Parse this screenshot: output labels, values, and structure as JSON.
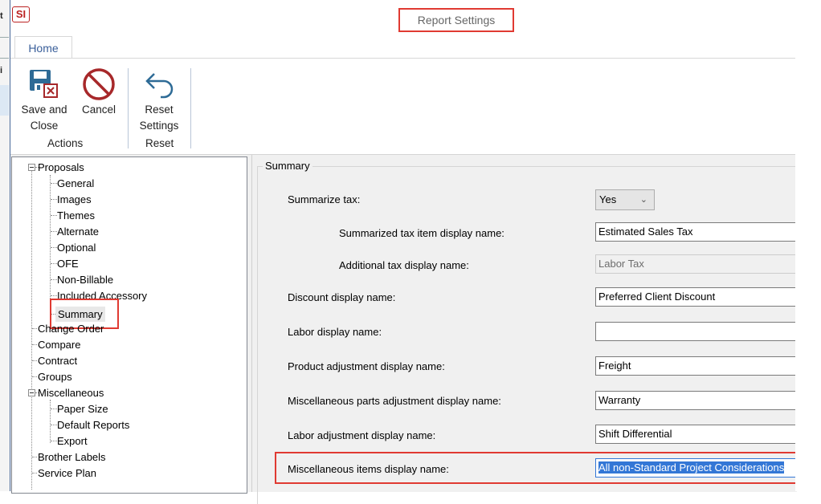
{
  "window": {
    "title": "Report Settings",
    "app_icon_text": "SI"
  },
  "ribbon": {
    "tabs": [
      {
        "label": "Home",
        "active": true
      }
    ],
    "groups": [
      {
        "label": "Actions",
        "buttons": [
          {
            "label_line1": "Save and",
            "label_line2": "Close",
            "icon": "save-close-icon"
          },
          {
            "label_line1": "Cancel",
            "label_line2": "",
            "icon": "cancel-icon"
          }
        ]
      },
      {
        "label": "Reset",
        "buttons": [
          {
            "label_line1": "Reset",
            "label_line2": "Settings",
            "icon": "undo-arrow-icon"
          }
        ]
      }
    ]
  },
  "tree": {
    "items": [
      {
        "label": "Proposals",
        "level": 0,
        "expanded": true
      },
      {
        "label": "General",
        "level": 1
      },
      {
        "label": "Images",
        "level": 1
      },
      {
        "label": "Themes",
        "level": 1
      },
      {
        "label": "Alternate",
        "level": 1
      },
      {
        "label": "Optional",
        "level": 1
      },
      {
        "label": "OFE",
        "level": 1
      },
      {
        "label": "Non-Billable",
        "level": 1
      },
      {
        "label": "Included Accessory",
        "level": 1
      },
      {
        "label": "Summary",
        "level": 1,
        "selected": true
      },
      {
        "label": "Change Order",
        "level": 0
      },
      {
        "label": "Compare",
        "level": 0
      },
      {
        "label": "Contract",
        "level": 0
      },
      {
        "label": "Groups",
        "level": 0
      },
      {
        "label": "Miscellaneous",
        "level": 0,
        "expanded": true
      },
      {
        "label": "Paper Size",
        "level": 1
      },
      {
        "label": "Default Reports",
        "level": 1
      },
      {
        "label": "Export",
        "level": 1
      },
      {
        "label": "Brother Labels",
        "level": 0
      },
      {
        "label": "Service Plan",
        "level": 0
      }
    ]
  },
  "summary": {
    "group_title": "Summary",
    "summarize_tax": {
      "label": "Summarize tax:",
      "value": "Yes",
      "chevron": "chevron-down-icon"
    },
    "fields": [
      {
        "label": "Summarized tax item display name:",
        "value": "Estimated Sales Tax",
        "indent": true
      },
      {
        "label": "Additional tax display name:",
        "value": "Labor Tax",
        "indent": true,
        "disabled": true
      },
      {
        "label": "Discount display name:",
        "value": "Preferred Client Discount"
      },
      {
        "label": "Labor display name:",
        "value": ""
      },
      {
        "label": "Product adjustment display name:",
        "value": "Freight"
      },
      {
        "label": "Miscellaneous parts adjustment display name:",
        "value": "Warranty"
      },
      {
        "label": "Labor adjustment display name:",
        "value": "Shift Differential"
      },
      {
        "label": "Miscellaneous items display name:",
        "value": "All non-Standard Project Considerations",
        "selected": true,
        "highlighted": true
      }
    ]
  },
  "colors": {
    "highlight_border": "#e03a32",
    "selection": "#3377d6",
    "icon_blue": "#2e6b96",
    "icon_red": "#a7282a"
  }
}
